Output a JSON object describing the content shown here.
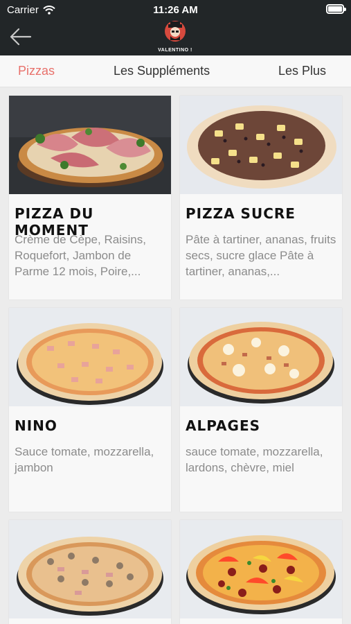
{
  "status_bar": {
    "carrier": "Carrier",
    "time": "11:26 AM"
  },
  "header": {
    "logo_text": "VALENTINO !",
    "back_icon": "arrow-left-icon"
  },
  "tabs": [
    {
      "label": "Pizzas",
      "active": true
    },
    {
      "label": "Les Suppléments",
      "active": false
    },
    {
      "label": "Les Plus",
      "active": false
    }
  ],
  "colors": {
    "accent": "#e8716b",
    "header_bg": "#222628",
    "description": "#8b8b8b"
  },
  "pizzas": [
    {
      "name": "PIZZA DU MOMENT",
      "description": "Crème de Cèpe, Raisins, Roquefort, Jambon de Parme 12 mois, Poire,..."
    },
    {
      "name": "PIZZA SUCRE",
      "description": "Pâte à tartiner, ananas, fruits secs, sucre glace Pâte à tartiner, ananas,..."
    },
    {
      "name": "NINO",
      "description": "Sauce tomate, mozzarella, jambon"
    },
    {
      "name": "ALPAGES",
      "description": "sauce tomate, mozzarella, lardons, chèvre, miel"
    },
    {
      "name": "",
      "description": ""
    },
    {
      "name": "",
      "description": ""
    }
  ]
}
